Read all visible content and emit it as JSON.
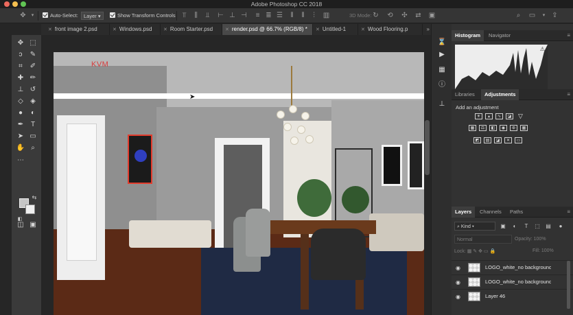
{
  "window": {
    "app_title": "Adobe Photoshop CC 2018"
  },
  "options_bar": {
    "auto_select_label": "Auto-Select:",
    "auto_select_value": "Layer",
    "show_transform_label": "Show Transform Controls",
    "mode_3d_label": "3D Mode:"
  },
  "tabs": [
    {
      "label": "front image 2.psd"
    },
    {
      "label": "Windows.psd"
    },
    {
      "label": "Room Starter.psd"
    },
    {
      "label": "render.psd @ 66.7% (RGB/8) *"
    },
    {
      "label": "Untitled-1"
    },
    {
      "label": "Wood Flooring.p"
    }
  ],
  "canvas": {
    "watermark": "KVM"
  },
  "panels": {
    "top_tabs": {
      "histogram": "Histogram",
      "navigator": "Navigator"
    },
    "mid_tabs": {
      "libraries": "Libraries",
      "adjustments": "Adjustments"
    },
    "add_adjustment_label": "Add an adjustment",
    "layers_tabs": {
      "layers": "Layers",
      "channels": "Channels",
      "paths": "Paths"
    },
    "kind_filter": "Kind",
    "blend_mode": "Normal",
    "opacity_label": "Opacity:",
    "opacity_value": "100%",
    "lock_label": "Lock:",
    "fill_label": "Fill:",
    "fill_value": "100%",
    "layers": [
      {
        "name": "LOGO_white_no background"
      },
      {
        "name": "LOGO_white_no background"
      },
      {
        "name": "Layer 46"
      }
    ]
  },
  "colors": {
    "accent_active_tab": "#494949",
    "panel_bg": "#323232",
    "toolbar_bg": "#3a3a3a"
  }
}
